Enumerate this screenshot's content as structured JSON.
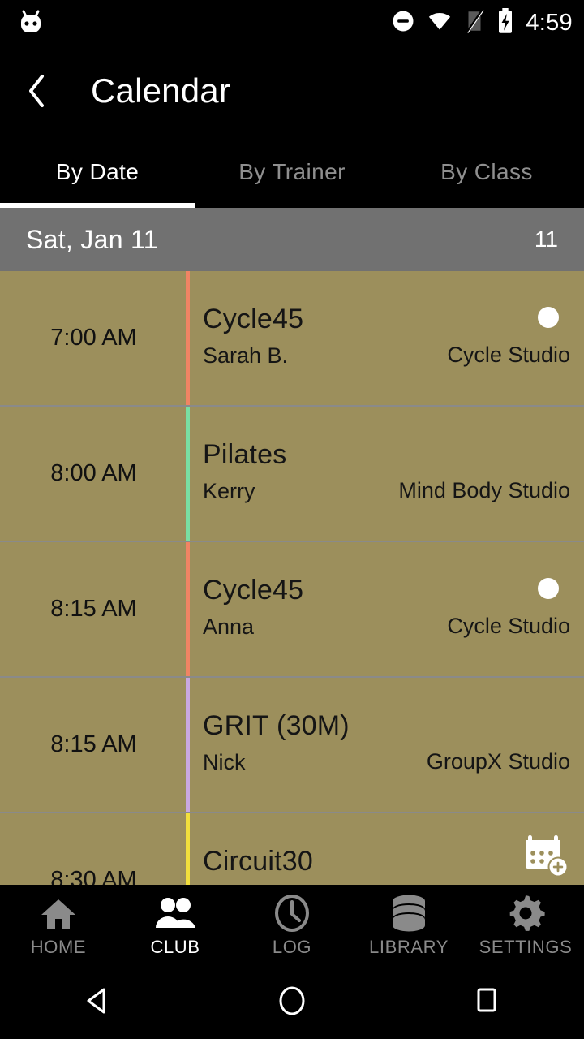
{
  "status_bar": {
    "app_icon": "android-robot-icon",
    "dnd_icon": "do-not-disturb-icon",
    "wifi_icon": "wifi-icon",
    "signal_icon": "no-sim-signal-icon",
    "battery_icon": "battery-charging-icon",
    "time": "4:59"
  },
  "app_bar": {
    "back_icon": "back-chevron-icon",
    "title": "Calendar"
  },
  "tabs": {
    "items": [
      {
        "label": "By Date",
        "active": true
      },
      {
        "label": "By Trainer",
        "active": false
      },
      {
        "label": "By Class",
        "active": false
      }
    ]
  },
  "date_header": {
    "title": "Sat, Jan 11",
    "day_number": "11"
  },
  "schedule": {
    "rows": [
      {
        "time": "7:00 AM",
        "class": "Cycle45",
        "trainer": "Sarah B.",
        "studio": "Cycle Studio",
        "accent": "#f08464",
        "indicator": true
      },
      {
        "time": "8:00 AM",
        "class": "Pilates",
        "trainer": "Kerry",
        "studio": "Mind Body Studio",
        "accent": "#79dfa2",
        "indicator": false
      },
      {
        "time": "8:15 AM",
        "class": "Cycle45",
        "trainer": "Anna",
        "studio": "Cycle Studio",
        "accent": "#f08464",
        "indicator": true
      },
      {
        "time": "8:15 AM",
        "class": "GRIT (30M)",
        "trainer": "Nick",
        "studio": "GroupX Studio",
        "accent": "#c9a8e0",
        "indicator": false
      },
      {
        "time": "8:30 AM",
        "class": "Circuit30",
        "trainer": "",
        "studio": "",
        "accent": "#f2df3d",
        "indicator": false
      }
    ]
  },
  "fab": {
    "icon": "add-to-calendar-icon"
  },
  "bottom_nav": {
    "items": [
      {
        "label": "HOME",
        "icon": "home-icon",
        "active": false
      },
      {
        "label": "CLUB",
        "icon": "people-icon",
        "active": true
      },
      {
        "label": "LOG",
        "icon": "clock-icon",
        "active": false
      },
      {
        "label": "LIBRARY",
        "icon": "database-icon",
        "active": false
      },
      {
        "label": "SETTINGS",
        "icon": "gear-icon",
        "active": false
      }
    ]
  },
  "system_nav": {
    "back_icon": "triangle-back-icon",
    "home_icon": "circle-home-icon",
    "recents_icon": "square-recents-icon"
  },
  "colors": {
    "row_background": "#9c8f5c",
    "date_header": "#717171",
    "app_background": "#000000",
    "active_tab": "#ffffff",
    "inactive_tab": "#8f8f8f"
  }
}
